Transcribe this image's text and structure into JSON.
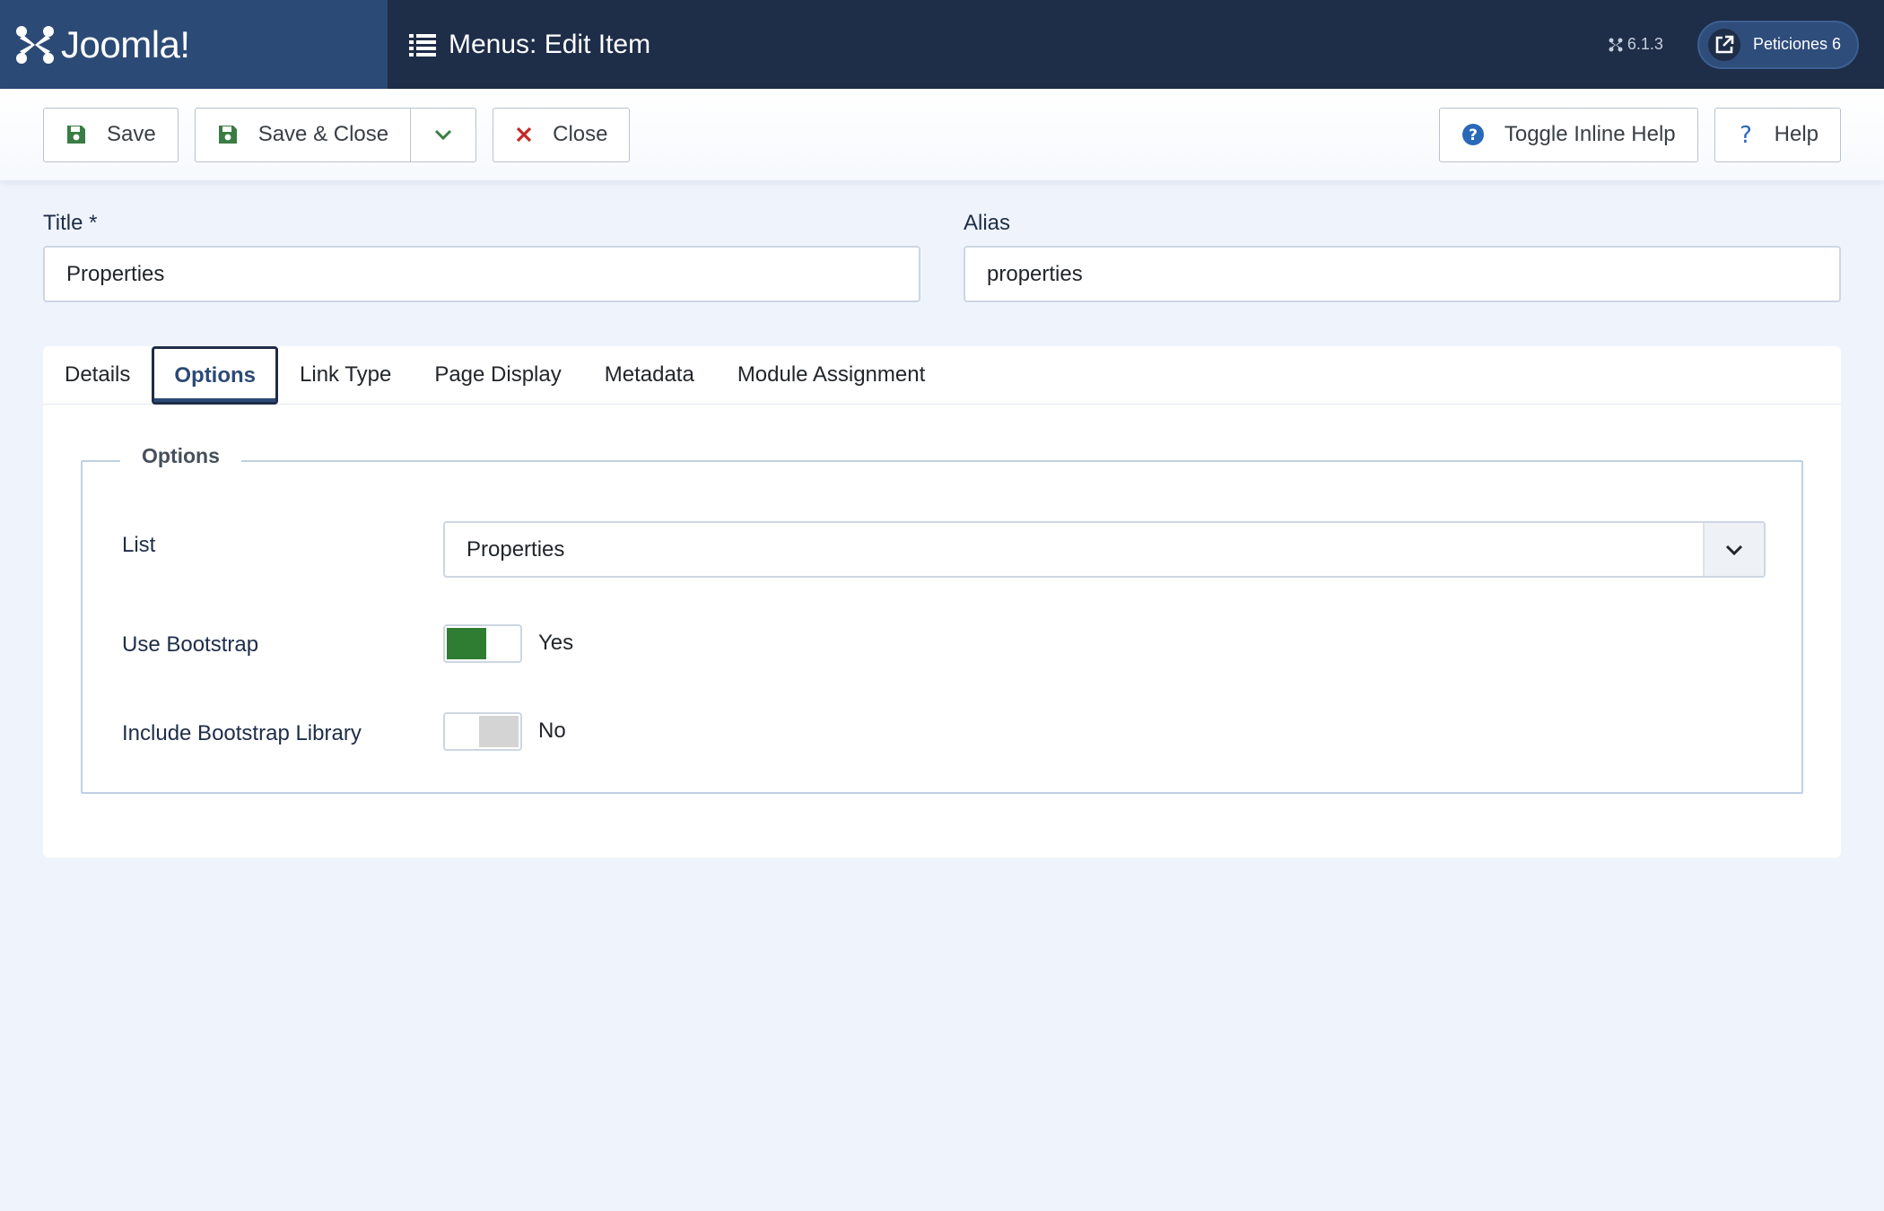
{
  "header": {
    "brand": "Joomla!",
    "title": "Menus: Edit Item",
    "version": "6.1.3",
    "site_link": "Peticiones 6"
  },
  "toolbar": {
    "save": "Save",
    "save_close": "Save & Close",
    "close": "Close",
    "toggle_help": "Toggle Inline Help",
    "help": "Help"
  },
  "fields": {
    "title_label": "Title *",
    "title_value": "Properties",
    "alias_label": "Alias",
    "alias_value": "properties"
  },
  "tabs": [
    {
      "label": "Details"
    },
    {
      "label": "Options"
    },
    {
      "label": "Link Type"
    },
    {
      "label": "Page Display"
    },
    {
      "label": "Metadata"
    },
    {
      "label": "Module Assignment"
    }
  ],
  "options": {
    "legend": "Options",
    "list_label": "List",
    "list_value": "Properties",
    "use_bootstrap_label": "Use Bootstrap",
    "use_bootstrap_value": "Yes",
    "include_bootstrap_label": "Include Bootstrap Library",
    "include_bootstrap_value": "No"
  },
  "colors": {
    "header": "#1e2d48",
    "brand": "#2c4a76",
    "switch_on": "#2f7d32"
  }
}
